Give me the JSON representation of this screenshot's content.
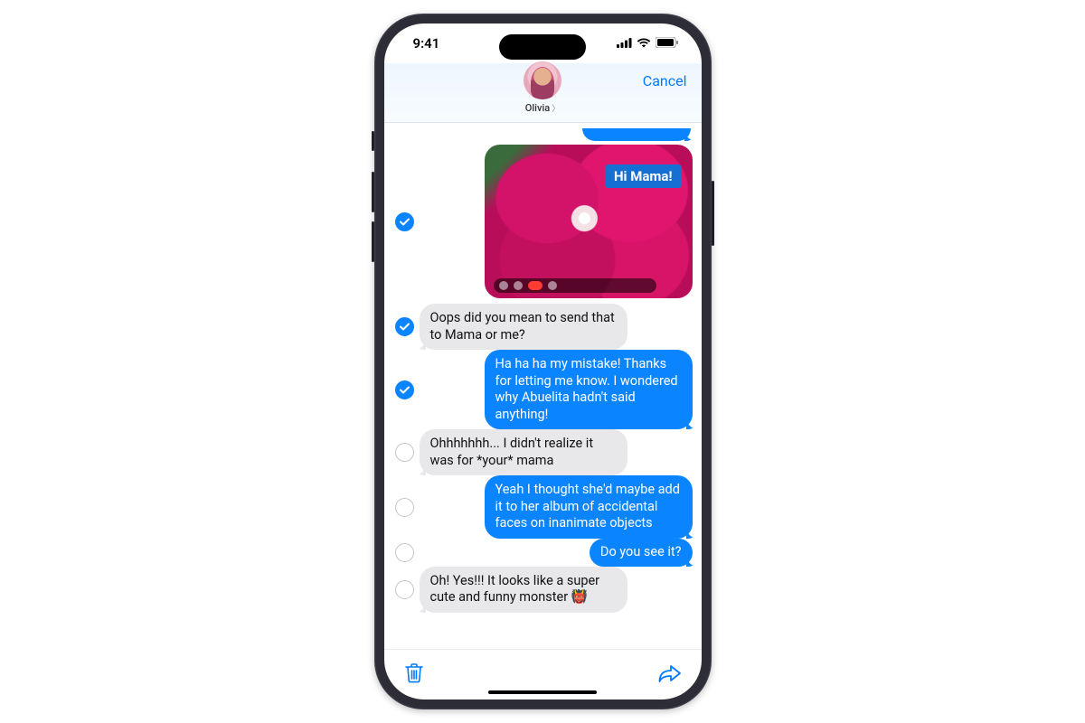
{
  "status": {
    "time": "9:41"
  },
  "header": {
    "contact_name": "Olivia",
    "cancel_label": "Cancel"
  },
  "image_message": {
    "caption": "Hi Mama!",
    "selected": true
  },
  "messages": [
    {
      "id": 0,
      "side": "received",
      "selected": true,
      "text": "Oops did you mean to send that to Mama or me?"
    },
    {
      "id": 1,
      "side": "sent",
      "selected": true,
      "text": "Ha ha ha my mistake! Thanks for letting me know. I wondered why Abuelita hadn't said anything!"
    },
    {
      "id": 2,
      "side": "received",
      "selected": false,
      "text": "Ohhhhhhh... I didn't realize it was for *your* mama"
    },
    {
      "id": 3,
      "side": "sent",
      "selected": false,
      "text": "Yeah I thought she'd maybe add it to her album of accidental faces on inanimate objects"
    },
    {
      "id": 4,
      "side": "sent",
      "selected": false,
      "text": "Do you see it?"
    },
    {
      "id": 5,
      "side": "received",
      "selected": false,
      "text": "Oh! Yes!!! It looks like a super cute and funny monster 👹"
    }
  ]
}
